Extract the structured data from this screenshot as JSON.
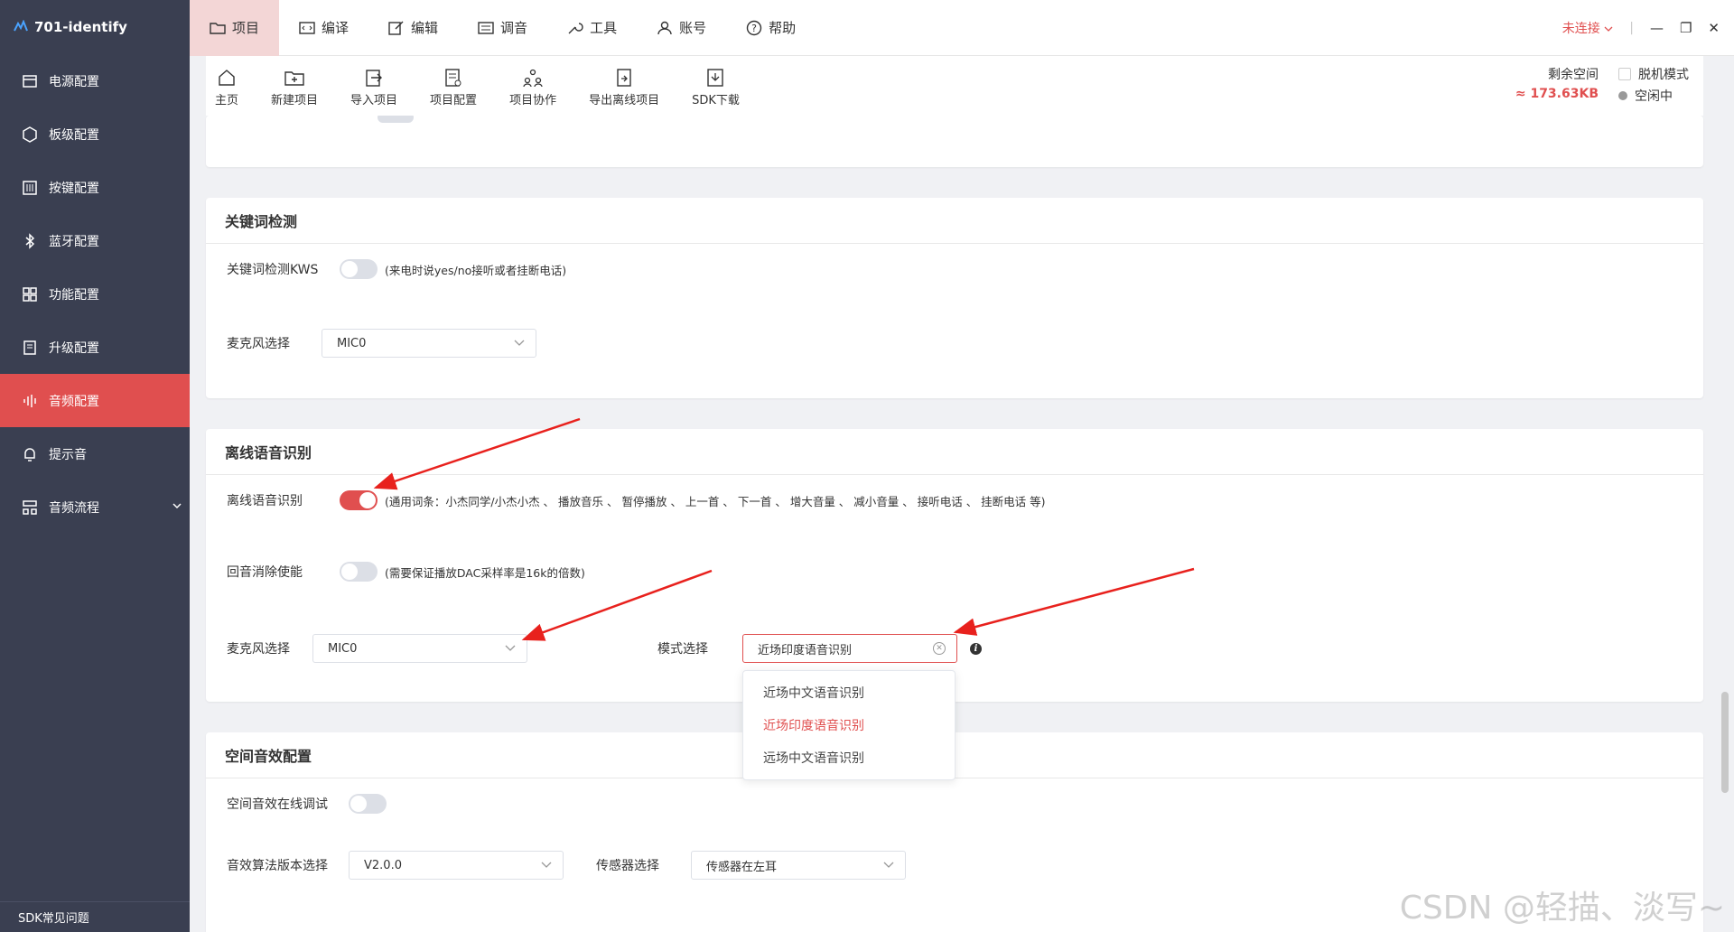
{
  "app": {
    "title": "701-identify"
  },
  "sidebar": {
    "items": [
      {
        "label": "电源配置"
      },
      {
        "label": "板级配置"
      },
      {
        "label": "按键配置"
      },
      {
        "label": "蓝牙配置"
      },
      {
        "label": "功能配置"
      },
      {
        "label": "升级配置"
      },
      {
        "label": "音频配置"
      },
      {
        "label": "提示音"
      },
      {
        "label": "音频流程"
      }
    ],
    "footer": "SDK常见问题"
  },
  "menubar": {
    "items": [
      {
        "label": "项目"
      },
      {
        "label": "编译"
      },
      {
        "label": "编辑"
      },
      {
        "label": "调音"
      },
      {
        "label": "工具"
      },
      {
        "label": "账号"
      },
      {
        "label": "帮助"
      }
    ],
    "connection_status": "未连接"
  },
  "toolbar": {
    "items": [
      {
        "label": "主页"
      },
      {
        "label": "新建项目"
      },
      {
        "label": "导入项目"
      },
      {
        "label": "项目配置"
      },
      {
        "label": "项目协作"
      },
      {
        "label": "导出离线项目"
      },
      {
        "label": "SDK下载"
      }
    ],
    "space_label": "剩余空间",
    "space_value": "≈ 173.63KB",
    "offline_mode_label": "脱机模式",
    "status_label": "空闲中"
  },
  "kws": {
    "title": "关键词检测",
    "kws_label": "关键词检测KWS",
    "kws_hint": "(来电时说yes/no接听或者挂断电话)",
    "mic_label": "麦克风选择",
    "mic_value": "MIC0"
  },
  "asr": {
    "title": "离线语音识别",
    "asr_label": "离线语音识别",
    "asr_hint": "(通用词条：小杰同学/小杰小杰 、 播放音乐 、 暂停播放 、 上一首 、 下一首 、 增大音量 、 减小音量 、 接听电话 、 挂断电话 等)",
    "aec_label": "回音消除使能",
    "aec_hint": "(需要保证播放DAC采样率是16k的倍数)",
    "mic_label": "麦克风选择",
    "mic_value": "MIC0",
    "mode_label": "模式选择",
    "mode_value": "近场印度语音识别",
    "mode_options": [
      "近场中文语音识别",
      "近场印度语音识别",
      "远场中文语音识别"
    ]
  },
  "spatial": {
    "title": "空间音效配置",
    "online_label": "空间音效在线调试",
    "algo_label": "音效算法版本选择",
    "algo_value": "V2.0.0",
    "sensor_label": "传感器选择",
    "sensor_value": "传感器在左耳"
  },
  "watermark": "CSDN @轻描、淡写~",
  "colors": {
    "accent": "#e04f4f",
    "sidebar_bg": "#3a3f51"
  }
}
